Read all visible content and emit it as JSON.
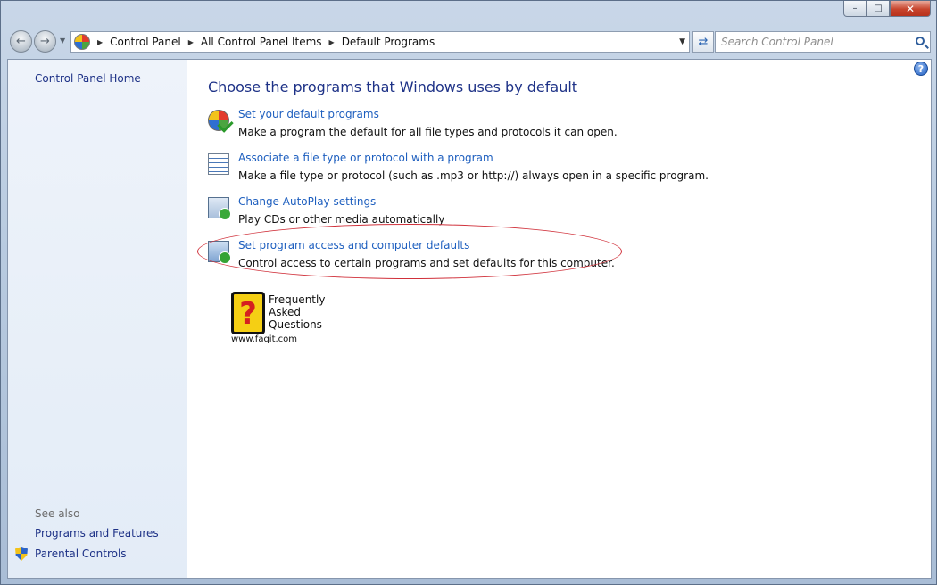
{
  "window": {
    "minimize": "–",
    "maximize": "□",
    "close": "✕"
  },
  "nav": {
    "back_icon": "back-arrow-icon",
    "forward_icon": "forward-arrow-icon",
    "breadcrumb": [
      "Control Panel",
      "All Control Panel Items",
      "Default Programs"
    ],
    "search_placeholder": "Search Control Panel"
  },
  "sidebar": {
    "home": "Control Panel Home",
    "see_also": "See also",
    "links": [
      "Programs and Features",
      "Parental Controls"
    ]
  },
  "main": {
    "title": "Choose the programs that Windows uses by default",
    "tasks": [
      {
        "link": "Set your default programs",
        "desc": "Make a program the default for all file types and protocols it can open.",
        "icon": "default-programs-icon"
      },
      {
        "link": "Associate a file type or protocol with a program",
        "desc": "Make a file type or protocol (such as .mp3 or http://) always open in a specific program.",
        "icon": "file-association-icon"
      },
      {
        "link": "Change AutoPlay settings",
        "desc": "Play CDs or other media automatically",
        "icon": "autoplay-icon"
      },
      {
        "link": "Set program access and computer defaults",
        "desc": "Control access to certain programs and set defaults for this computer.",
        "icon": "program-access-icon"
      }
    ]
  },
  "faq_logo": {
    "lines": "Frequently\nAsked\nQuestions",
    "url": "www.faqit.com",
    "mark": "?"
  },
  "colors": {
    "link": "#1e5fbf",
    "title": "#1e3287",
    "highlight": "#d0303a"
  }
}
